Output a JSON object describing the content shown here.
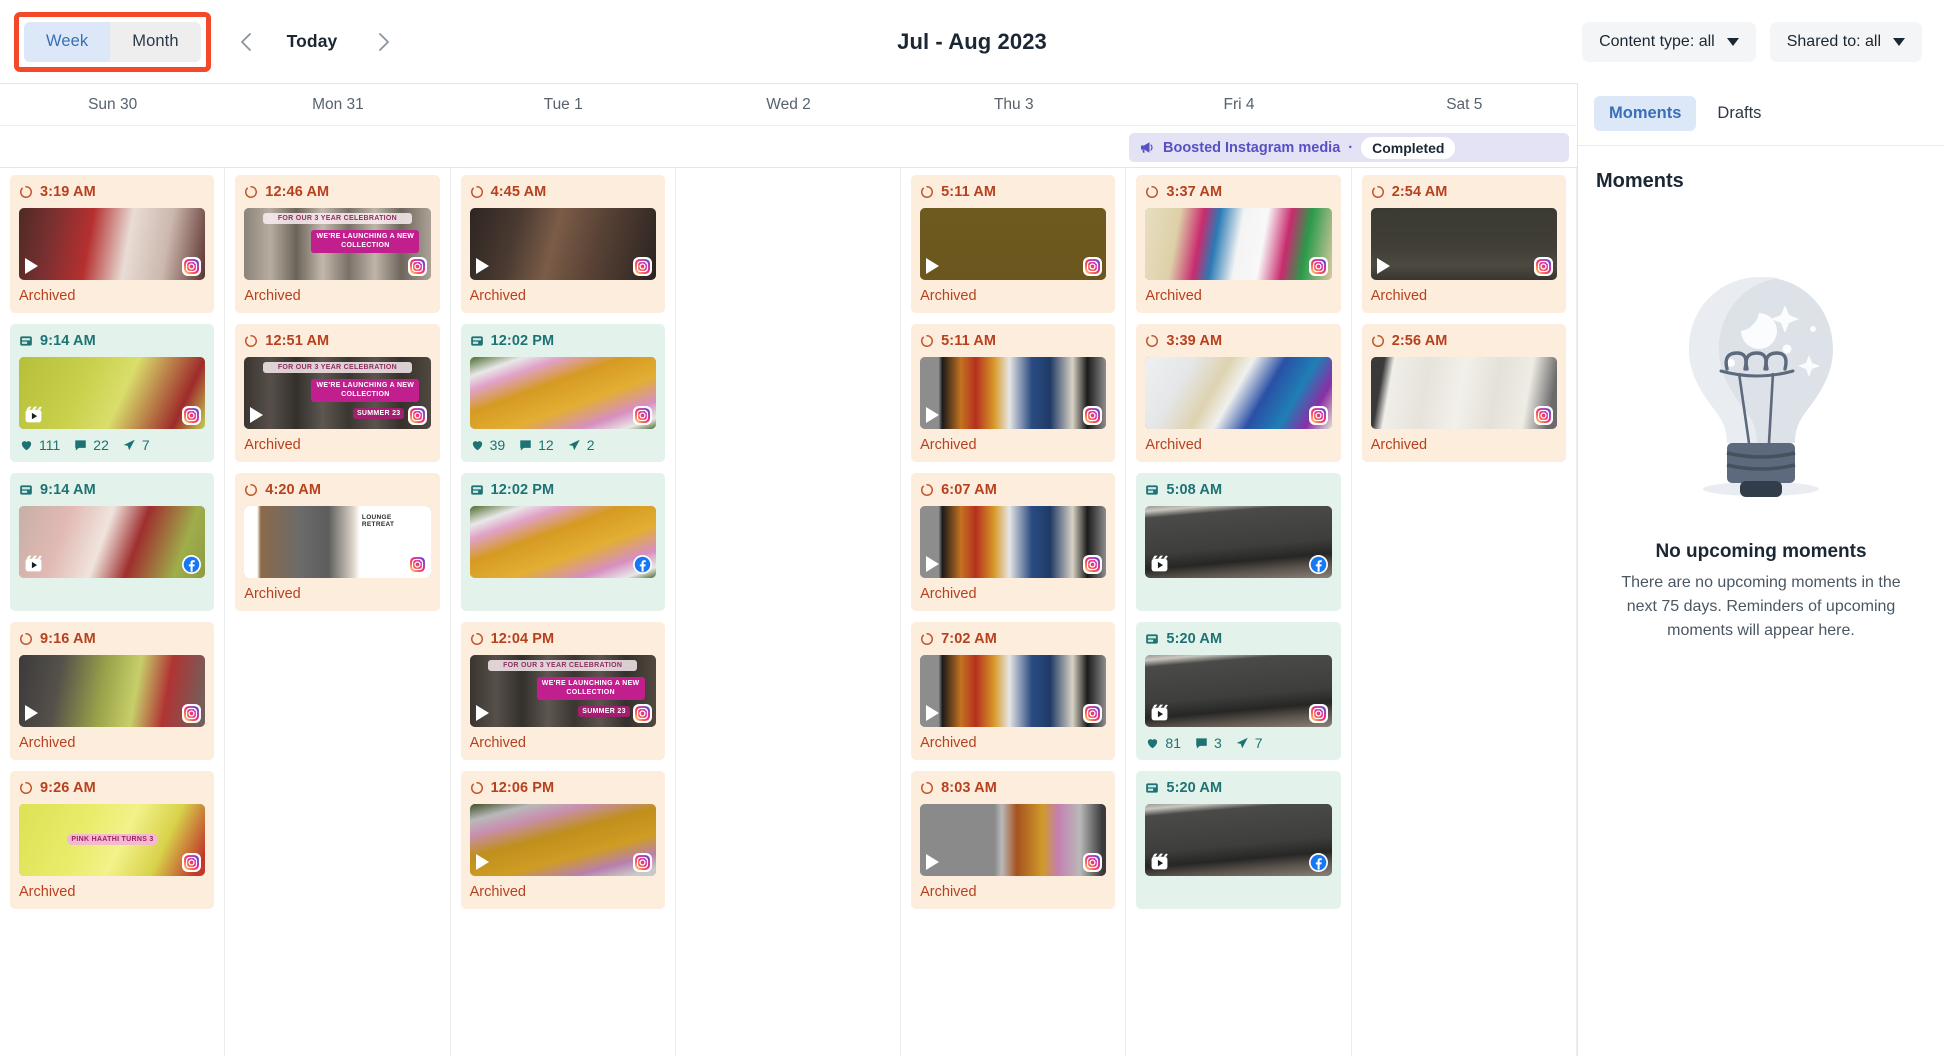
{
  "toolbar": {
    "view_week": "Week",
    "view_month": "Month",
    "prev_label": "chevron-left-icon",
    "today_label": "Today",
    "next_label": "chevron-right-icon",
    "range_title": "Jul - Aug 2023",
    "content_type_filter": "Content type: all",
    "shared_to_filter": "Shared to: all"
  },
  "calendar": {
    "day_headers": [
      "Sun 30",
      "Mon 31",
      "Tue 1",
      "Wed 2",
      "Thu 3",
      "Fri 4",
      "Sat 5"
    ],
    "all_day_banner": {
      "icon": "megaphone-icon",
      "label": "Boosted Instagram media",
      "separator": "·",
      "status": "Completed"
    },
    "columns": [
      {
        "day": "Sun 30",
        "cards": [
          {
            "time": "3:19 AM",
            "state": "archived",
            "status_label": "Archived",
            "network": "instagram",
            "media": "video",
            "thumb": "baby-red-dress",
            "overlays": []
          },
          {
            "time": "9:14 AM",
            "state": "published",
            "network": "instagram",
            "media": "reel",
            "thumb": "yellow-cloth",
            "overlays": [],
            "stats": {
              "likes": "111",
              "comments": "22",
              "shares": "7"
            }
          },
          {
            "time": "9:14 AM",
            "state": "published",
            "network": "facebook",
            "media": "reel",
            "thumb": "pink-room",
            "overlays": []
          },
          {
            "time": "9:16 AM",
            "state": "archived",
            "status_label": "Archived",
            "network": "instagram",
            "media": "video",
            "thumb": "green-table",
            "overlays": []
          },
          {
            "time": "9:26 AM",
            "state": "archived",
            "status_label": "Archived",
            "network": "instagram",
            "media": "image",
            "thumb": "yellow-fabric",
            "overlays": [
              {
                "text": "PINK HAATHI TURNS 3",
                "style": "pinkpill"
              }
            ]
          }
        ]
      },
      {
        "day": "Mon 31",
        "cards": [
          {
            "time": "12:46 AM",
            "state": "archived",
            "status_label": "Archived",
            "network": "instagram",
            "media": "image",
            "thumb": "bamboo-plate",
            "overlays": [
              {
                "text": "FOR OUR 3 YEAR CELEBRATION",
                "style": "lightpill"
              },
              {
                "text": "WE'RE LAUNCHING A NEW COLLECTION",
                "style": "magentapill"
              }
            ]
          },
          {
            "time": "12:51 AM",
            "state": "archived",
            "status_label": "Archived",
            "network": "instagram",
            "media": "video",
            "thumb": "bamboo-plate-dark",
            "overlays": [
              {
                "text": "FOR OUR 3 YEAR CELEBRATION",
                "style": "lightpill"
              },
              {
                "text": "WE'RE LAUNCHING A NEW COLLECTION",
                "style": "magentapill"
              },
              {
                "text": "SUMMER 23",
                "style": "magentapill"
              }
            ]
          },
          {
            "time": "4:20 AM",
            "state": "archived",
            "status_label": "Archived",
            "network": "instagram",
            "media": "image",
            "thumb": "lounge-retreat",
            "overlays": [
              {
                "text": "LOUNGE RETREAT",
                "style": "plain"
              }
            ]
          }
        ]
      },
      {
        "day": "Tue 1",
        "cards": [
          {
            "time": "4:45 AM",
            "state": "archived",
            "status_label": "Archived",
            "network": "instagram",
            "media": "video",
            "thumb": "dark-portrait",
            "overlays": []
          },
          {
            "time": "12:02 PM",
            "state": "published",
            "network": "instagram",
            "media": "image",
            "thumb": "yellow-pink-rug",
            "overlays": [],
            "stats": {
              "likes": "39",
              "comments": "12",
              "shares": "2"
            }
          },
          {
            "time": "12:02 PM",
            "state": "published",
            "network": "facebook",
            "media": "image",
            "thumb": "yellow-pink-rug",
            "overlays": []
          },
          {
            "time": "12:04 PM",
            "state": "archived",
            "status_label": "Archived",
            "network": "instagram",
            "media": "video",
            "thumb": "bamboo-plate-dark",
            "overlays": [
              {
                "text": "FOR OUR 3 YEAR CELEBRATION",
                "style": "lightpill"
              },
              {
                "text": "WE'RE LAUNCHING A NEW COLLECTION",
                "style": "magentapill"
              },
              {
                "text": "SUMMER 23",
                "style": "magentapill"
              }
            ]
          },
          {
            "time": "12:06 PM",
            "state": "archived",
            "status_label": "Archived",
            "network": "instagram",
            "media": "video",
            "thumb": "yellow-rug-dark",
            "overlays": []
          }
        ]
      },
      {
        "day": "Wed 2",
        "cards": []
      },
      {
        "day": "Thu 3",
        "cards": [
          {
            "time": "5:11 AM",
            "state": "archived",
            "status_label": "Archived",
            "network": "instagram",
            "media": "video",
            "thumb": "olive-solid",
            "overlays": []
          },
          {
            "time": "5:11 AM",
            "state": "archived",
            "status_label": "Archived",
            "network": "instagram",
            "media": "video",
            "thumb": "phone-slippers",
            "overlays": []
          },
          {
            "time": "6:07 AM",
            "state": "archived",
            "status_label": "Archived",
            "network": "instagram",
            "media": "video",
            "thumb": "phone-slippers",
            "overlays": []
          },
          {
            "time": "7:02 AM",
            "state": "archived",
            "status_label": "Archived",
            "network": "instagram",
            "media": "video",
            "thumb": "phone-slippers",
            "overlays": []
          },
          {
            "time": "8:03 AM",
            "state": "archived",
            "status_label": "Archived",
            "network": "instagram",
            "media": "video",
            "thumb": "grey-orange",
            "overlays": []
          }
        ]
      },
      {
        "day": "Fri 4",
        "cards": [
          {
            "time": "3:37 AM",
            "state": "archived",
            "status_label": "Archived",
            "network": "instagram",
            "media": "image",
            "thumb": "plaid-white",
            "overlays": []
          },
          {
            "time": "3:39 AM",
            "state": "archived",
            "status_label": "Archived",
            "network": "instagram",
            "media": "image",
            "thumb": "blue-plaid",
            "overlays": []
          },
          {
            "time": "5:08 AM",
            "state": "published",
            "network": "facebook",
            "media": "reel",
            "thumb": "grey-sofa",
            "overlays": []
          },
          {
            "time": "5:20 AM",
            "state": "published",
            "network": "instagram",
            "media": "reel",
            "thumb": "grey-sofa",
            "overlays": [],
            "stats": {
              "likes": "81",
              "comments": "3",
              "shares": "7"
            }
          },
          {
            "time": "5:20 AM",
            "state": "published",
            "network": "facebook",
            "media": "reel",
            "thumb": "grey-sofa",
            "overlays": []
          }
        ]
      },
      {
        "day": "Sat 5",
        "cards": [
          {
            "time": "2:54 AM",
            "state": "archived",
            "status_label": "Archived",
            "network": "instagram",
            "media": "video",
            "thumb": "dark-fur",
            "overlays": []
          },
          {
            "time": "2:56 AM",
            "state": "archived",
            "status_label": "Archived",
            "network": "instagram",
            "media": "image",
            "thumb": "white-pillows",
            "overlays": []
          }
        ]
      }
    ]
  },
  "right_panel": {
    "tabs": [
      {
        "label": "Moments",
        "active": true
      },
      {
        "label": "Drafts",
        "active": false
      }
    ],
    "section_title": "Moments",
    "empty_state": {
      "illustration": "lightbulb-icon",
      "heading": "No upcoming moments",
      "body": "There are no upcoming moments in the next 75 days. Reminders of upcoming moments will appear here."
    }
  },
  "colors": {
    "archived_bg": "#fdeddc",
    "archived_text": "#b7411f",
    "published_bg": "#e4f2ec",
    "published_text": "#1d7373",
    "accent_blue": "#3a6fb5",
    "boost_purple": "#5a4fc4",
    "highlight_red": "#f4482a"
  }
}
